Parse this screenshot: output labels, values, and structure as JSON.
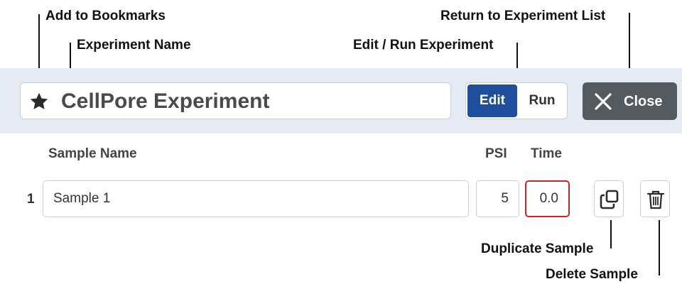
{
  "callouts": {
    "bookmark": "Add to Bookmarks",
    "experiment_name": "Experiment Name",
    "edit_run": "Edit / Run Experiment",
    "return_list": "Return to Experiment List",
    "duplicate": "Duplicate Sample",
    "delete": "Delete Sample"
  },
  "header": {
    "experiment_name": "CellPore Experiment",
    "bookmark_icon": "star-icon",
    "mode_toggle": {
      "edit_label": "Edit",
      "run_label": "Run",
      "active": "Edit"
    },
    "close_label": "Close",
    "close_icon": "close-icon"
  },
  "table": {
    "columns": {
      "sample_name": "Sample Name",
      "psi": "PSI",
      "time": "Time"
    },
    "rows": [
      {
        "index": "1",
        "sample_name": "Sample 1",
        "psi": "5",
        "time": "0.0"
      }
    ]
  },
  "icons": {
    "duplicate": "duplicate-icon",
    "delete": "trash-icon"
  },
  "colors": {
    "header_band": "#e6eaf2",
    "edit_active": "#1f4e9c",
    "close_button": "#555a5e",
    "time_error_border": "#c62828"
  }
}
